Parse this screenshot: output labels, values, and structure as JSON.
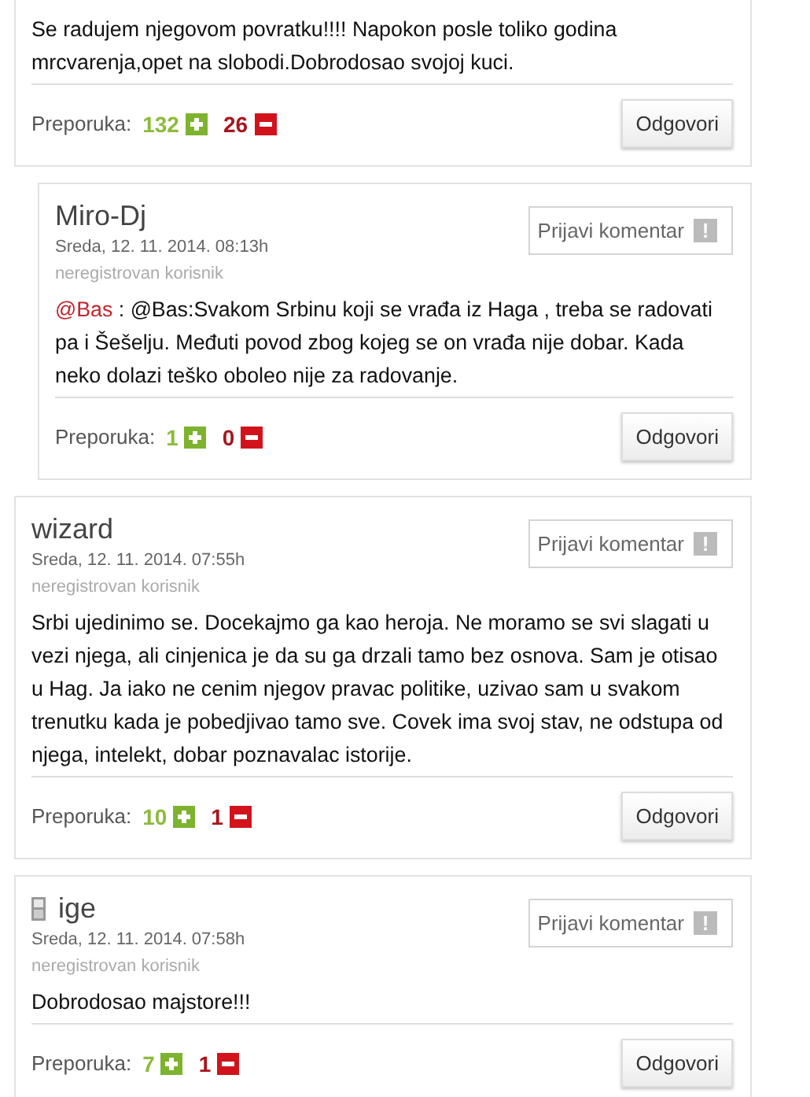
{
  "comments": [
    {
      "reply": false,
      "text": "Se radujem njegovom povratku!!!! Napokon posle toliko godina mrcvarenja,opet na slobodi.Dobrodosao svojoj kuci.",
      "rating_label": "Preporuka:",
      "likes": "132",
      "dislikes": "26",
      "reply_button": "Odgovori"
    },
    {
      "reply": true,
      "mobile": false,
      "author": "Miro-Dj",
      "date": "Sreda, 12. 11. 2014. 08:13h",
      "user_type": "neregistrovan korisnik",
      "report_button": "Prijavi komentar",
      "report_icon": "!",
      "mention": "@Bas",
      "text": " : @Bas:Svakom Srbinu koji se vrađa iz Haga , treba se radovati pa i Šešelju. Međuti povod zbog kojeg se on vrađa nije dobar. Kada neko dolazi teško oboleo nije za radovanje.",
      "rating_label": "Preporuka:",
      "likes": "1",
      "dislikes": "0",
      "reply_button": "Odgovori"
    },
    {
      "reply": false,
      "mobile": false,
      "author": "wizard",
      "date": "Sreda, 12. 11. 2014. 07:55h",
      "user_type": "neregistrovan korisnik",
      "report_button": "Prijavi komentar",
      "report_icon": "!",
      "text": "Srbi ujedinimo se. Docekajmo ga kao heroja. Ne moramo se svi slagati u vezi njega, ali cinjenica je da su ga drzali tamo bez osnova. Sam je otisao u Hag. Ja iako ne cenim njegov pravac politike, uzivao sam u svakom trenutku kada je pobedjivao tamo sve. Covek ima svoj stav, ne odstupa od njega, intelekt, dobar poznavalac istorije.",
      "rating_label": "Preporuka:",
      "likes": "10",
      "dislikes": "1",
      "reply_button": "Odgovori"
    },
    {
      "reply": false,
      "mobile": true,
      "author": "ige",
      "date": "Sreda, 12. 11. 2014. 07:58h",
      "user_type": "neregistrovan korisnik",
      "report_button": "Prijavi komentar",
      "report_icon": "!",
      "text": "Dobrodosao majstore!!!",
      "rating_label": "Preporuka:",
      "likes": "7",
      "dislikes": "1",
      "reply_button": "Odgovori"
    }
  ]
}
